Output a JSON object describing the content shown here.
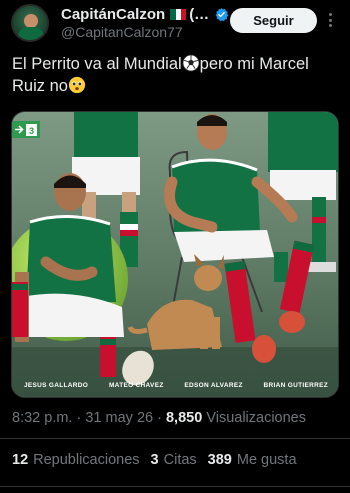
{
  "author": {
    "display_name": "CapitánCalzon",
    "name_suffix": "(…",
    "handle": "@CapitanCalzon77",
    "flag_colors": [
      "#006847",
      "#ffffff",
      "#ce1126"
    ],
    "verified_icon": "verified-badge-icon",
    "verified_color": "#1d9bf0"
  },
  "follow_label": "Seguir",
  "more_icon": "more-dots-icon",
  "tweet": {
    "text_part1": "El Perrito va al Mundial",
    "emoji1": "soccer-ball-icon",
    "text_part2": "pero mi Marcel Ruiz no",
    "emoji2": "pleading-face-icon"
  },
  "media": {
    "badge_number": "3",
    "player_captions": [
      "JESUS GALLARDO",
      "MATEO CHAVEZ",
      "EDSON ALVAREZ",
      "BRIAN GUTIERREZ"
    ]
  },
  "meta": {
    "time": "8:32 p.m.",
    "separator": "·",
    "date": "31 may 26",
    "views_count": "8,850",
    "views_label": "Visualizaciones"
  },
  "engagement": {
    "reposts_count": "12",
    "reposts_label": "Republicaciones",
    "quotes_count": "3",
    "quotes_label": "Citas",
    "likes_count": "389",
    "likes_label": "Me gusta"
  },
  "colors": {
    "background": "#000000",
    "text_primary": "#e7e9ea",
    "text_secondary": "#71767b",
    "follow_bg": "#eff3f4",
    "jersey_green": "#0f6b3f"
  }
}
